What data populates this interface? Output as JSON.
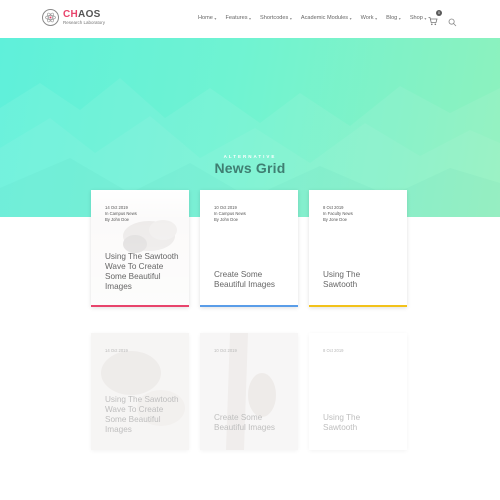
{
  "header": {
    "logo_name_highlight": "CH",
    "logo_name_rest": "AOS",
    "logo_subtitle": "Research Laboratory",
    "nav": [
      "Home",
      "Features",
      "Shortcodes",
      "Academic Modules",
      "Work",
      "Blog",
      "Shop"
    ],
    "cart_count": "0"
  },
  "hero": {
    "eyebrow": "ALTERNATIVE",
    "title": "News Grid"
  },
  "cards": [
    {
      "date": "14 Oct 2019",
      "category": "In Campus News",
      "author": "By John Doe",
      "title": "Using The Sawtooth Wave To Create Some Beautiful Images",
      "accent": "#e8446c"
    },
    {
      "date": "10 Oct 2019",
      "category": "In Campus News",
      "author": "By John Doe",
      "title": "Create Some Beautiful Images",
      "accent": "#5a9de8"
    },
    {
      "date": "8 Oct 2019",
      "category": "In Faculty News",
      "author": "By Jone Doe",
      "title": "Using The Sawtooth",
      "accent": "#f2c21b"
    },
    {
      "date": "14 Oct 2019",
      "title": "Using The Sawtooth Wave To Create Some Beautiful Images"
    },
    {
      "date": "10 Oct 2019",
      "title": "Create Some Beautiful Images"
    },
    {
      "date": "8 Oct 2019",
      "title": "Using The Sawtooth"
    }
  ],
  "colors": {
    "brand": "#e8446c",
    "hero_start": "#5ff0da",
    "hero_end": "#8ef2bd"
  }
}
